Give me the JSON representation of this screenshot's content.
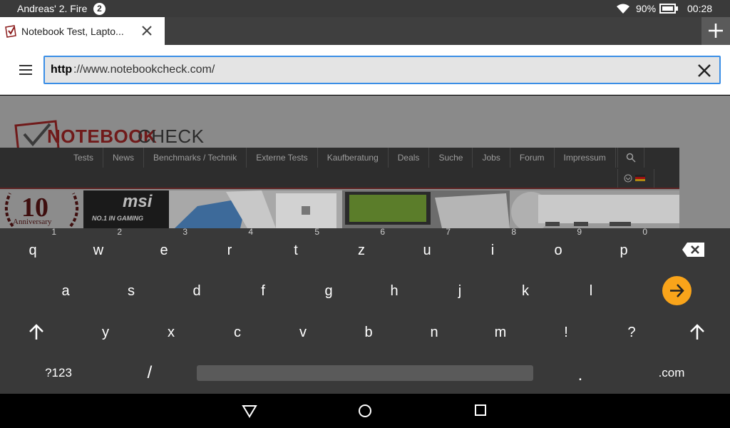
{
  "status_bar": {
    "device_name": "Andreas' 2. Fire",
    "notification_count": "2",
    "battery_percent": "90%",
    "time": "00:28",
    "icons": [
      "wifi-icon",
      "battery-icon"
    ]
  },
  "tabs": [
    {
      "title": "Notebook Test, Lapto...",
      "icon": "notebookcheck-favicon"
    }
  ],
  "address_bar": {
    "scheme": "http",
    "rest": "://www.notebookcheck.com/"
  },
  "page": {
    "logo_notebook": "NOTEBOOK",
    "logo_check": "CHECK",
    "nav": [
      "Tests",
      "News",
      "Benchmarks / Technik",
      "Externe Tests",
      "Kaufberatung",
      "Deals",
      "Suche",
      "Jobs",
      "Forum",
      "Impressum"
    ],
    "banner": {
      "anniversary_number": "10",
      "anniversary_label": "Anniversary",
      "msi_logo": "msi",
      "msi_tagline": "NO.1 IN GAMING"
    }
  },
  "keyboard": {
    "row1": [
      {
        "key": "q",
        "hint": "1"
      },
      {
        "key": "w",
        "hint": "2"
      },
      {
        "key": "e",
        "hint": "3"
      },
      {
        "key": "r",
        "hint": "4"
      },
      {
        "key": "t",
        "hint": "5"
      },
      {
        "key": "z",
        "hint": "6"
      },
      {
        "key": "u",
        "hint": "7"
      },
      {
        "key": "i",
        "hint": "8"
      },
      {
        "key": "o",
        "hint": "9"
      },
      {
        "key": "p",
        "hint": "0"
      }
    ],
    "row2": [
      "a",
      "s",
      "d",
      "f",
      "g",
      "h",
      "j",
      "k",
      "l"
    ],
    "row3": [
      "y",
      "x",
      "c",
      "v",
      "b",
      "n",
      "m",
      "!",
      "?"
    ],
    "symbols_label": "?123",
    "slash": "/",
    "period": ".",
    "dotcom": ".com"
  },
  "accent_color": "#f9a41a",
  "url_focus_color": "#3a8ee6"
}
